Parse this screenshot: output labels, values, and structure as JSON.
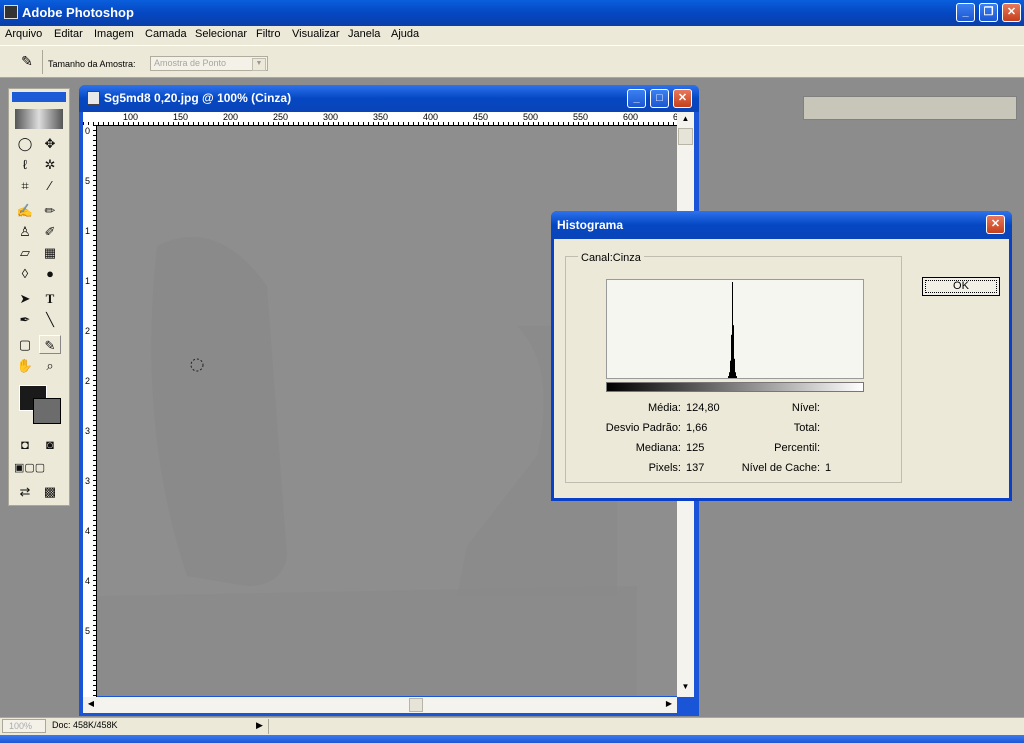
{
  "app": {
    "title": "Adobe Photoshop"
  },
  "menu": [
    "Arquivo",
    "Editar",
    "Imagem",
    "Camada",
    "Selecionar",
    "Filtro",
    "Visualizar",
    "Janela",
    "Ajuda"
  ],
  "options": {
    "sample_size_label": "Tamanho da Amostra:",
    "sample_size_value": "Amostra de Ponto"
  },
  "document": {
    "title": "Sg5md8 0,20.jpg @ 100% (Cinza)",
    "ruler_top": [
      "100",
      "150",
      "200",
      "250",
      "300",
      "350",
      "400",
      "450",
      "500",
      "550",
      "600",
      "6"
    ],
    "ruler_left": [
      "0",
      "5",
      "1",
      "1",
      "2",
      "2",
      "3",
      "3",
      "4",
      "4",
      "5"
    ]
  },
  "histogram": {
    "title": "Histograma",
    "channel_label": "Canal:Cinza",
    "ok_label": "OK",
    "stats": {
      "media_label": "Média:",
      "media_value": "124,80",
      "desvio_label": "Desvio Padrão:",
      "desvio_value": "1,66",
      "mediana_label": "Mediana:",
      "mediana_value": "125",
      "pixels_label": "Pixels:",
      "pixels_value": "137",
      "nivel_label": "Nível:",
      "nivel_value": "",
      "total_label": "Total:",
      "total_value": "",
      "percentil_label": "Percentil:",
      "percentil_value": "",
      "cache_label": "Nível de Cache:",
      "cache_value": "1"
    },
    "chart_data": {
      "type": "bar",
      "x": [
        121,
        122,
        123,
        124,
        125,
        126,
        127,
        128,
        129
      ],
      "values": [
        0.02,
        0.06,
        0.18,
        0.45,
        1.0,
        0.55,
        0.2,
        0.06,
        0.02
      ],
      "xlim": [
        0,
        255
      ]
    }
  },
  "status": {
    "zoom": "100%",
    "doc_size": "Doc: 458K/458K"
  },
  "colors": {
    "accent": "#0547c2",
    "canvas": "#8f8f8f",
    "chrome": "#ece9d8"
  },
  "icons": [
    "photoshop-icon",
    "minimize-icon",
    "restore-icon",
    "close-icon",
    "eyedropper-icon",
    "marquee-icon",
    "move-icon",
    "lasso-icon",
    "magic-wand-icon",
    "crop-icon",
    "slice-icon",
    "brush-icon",
    "pencil-icon",
    "stamp-icon",
    "history-brush-icon",
    "eraser-icon",
    "gradient-icon",
    "blur-icon",
    "dodge-icon",
    "path-select-icon",
    "type-icon",
    "pen-icon",
    "line-icon",
    "notes-icon",
    "eyedropper-tool-icon",
    "hand-icon",
    "zoom-icon"
  ]
}
